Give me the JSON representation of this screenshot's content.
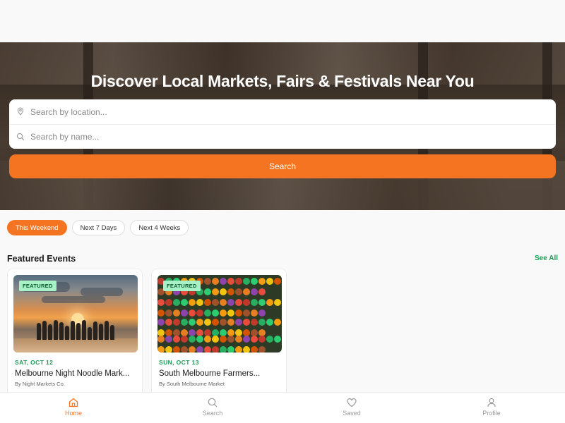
{
  "hero": {
    "title": "Discover Local Markets, Fairs & Festivals Near You",
    "location_placeholder": "Search by location...",
    "name_placeholder": "Search by name...",
    "search_button": "Search"
  },
  "filters": [
    {
      "label": "This Weekend",
      "active": true
    },
    {
      "label": "Next 7 Days",
      "active": false
    },
    {
      "label": "Next 4 Weeks",
      "active": false
    }
  ],
  "featured": {
    "title": "Featured Events",
    "see_all": "See All",
    "events": [
      {
        "badge": "FEATURED",
        "date": "SAT, OCT 12",
        "title": "Melbourne Night Noodle Mark...",
        "organizer": "By Night Markets Co."
      },
      {
        "badge": "FEATURED",
        "date": "SUN, OCT 13",
        "title": "South Melbourne Farmers...",
        "organizer": "By South Melbourne Market"
      }
    ]
  },
  "nav": [
    {
      "label": "Home",
      "icon": "home-icon",
      "active": true
    },
    {
      "label": "Search",
      "icon": "search-icon",
      "active": false
    },
    {
      "label": "Saved",
      "icon": "heart-icon",
      "active": false
    },
    {
      "label": "Profile",
      "icon": "profile-icon",
      "active": false
    }
  ],
  "colors": {
    "accent": "#f57421",
    "green": "#1e9a55",
    "badge_bg": "#a8f0c6"
  }
}
